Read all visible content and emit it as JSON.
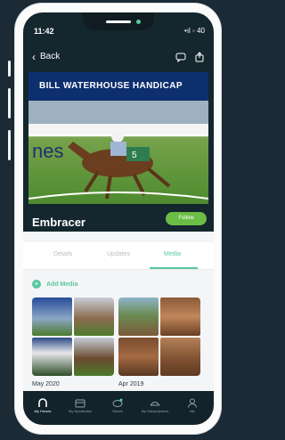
{
  "status_bar": {
    "time": "11:42",
    "right": "•ıl ◦ 40"
  },
  "header": {
    "back_label": "Back"
  },
  "hero": {
    "banner_text": "BILL WATERHOUSE HANDICAP",
    "horse_name": "Embracer",
    "follow_label": "Follow"
  },
  "tabs": [
    {
      "label": "Details"
    },
    {
      "label": "Updates"
    },
    {
      "label": "Media"
    }
  ],
  "media": {
    "section_title": "Add Media",
    "albums": [
      {
        "date": "May 2020"
      },
      {
        "date": "Apr 2019"
      }
    ]
  },
  "bottom_nav": [
    {
      "label": "My Horses"
    },
    {
      "label": "My Syndicates"
    },
    {
      "label": "Races"
    },
    {
      "label": "My Subscriptions"
    },
    {
      "label": "Me"
    }
  ],
  "colors": {
    "accent": "#58c8a0",
    "follow_button": "#6bbd45",
    "navy": "#12232b"
  }
}
